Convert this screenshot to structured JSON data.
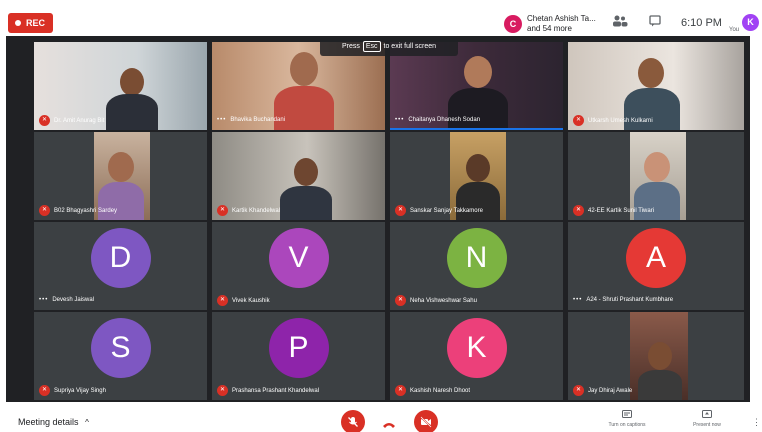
{
  "recording": {
    "label": "REC"
  },
  "presenter": {
    "avatar_letter": "C",
    "line1": "Chetan Ashish Ta...",
    "line2": "and 54 more"
  },
  "topbar": {
    "time": "6:10 PM",
    "you_label": "You",
    "self_avatar_letter": "K"
  },
  "banner": {
    "press": "Press",
    "key": "Esc",
    "rest": "to exit full screen"
  },
  "tiles": [
    {
      "name": "Dr. Amit Anurag Bit",
      "kind": "video"
    },
    {
      "name": "Bhavika Buchandani",
      "kind": "video"
    },
    {
      "name": "Chaitanya Dhanesh Sodan",
      "kind": "video"
    },
    {
      "name": "Utkarsh Umesh Kulkarni",
      "kind": "video"
    },
    {
      "name": "B02 Bhagyashri Sardey",
      "kind": "video"
    },
    {
      "name": "Kartik Khandelwal",
      "kind": "video"
    },
    {
      "name": "Sanskar Sanjay Takkamore",
      "kind": "video"
    },
    {
      "name": "42-EE Kartik Sunil Tiwari",
      "kind": "video"
    },
    {
      "name": "Devesh Jaiswal",
      "kind": "avatar",
      "letter": "D",
      "color": "#7e57c2"
    },
    {
      "name": "Vivek Kaushik",
      "kind": "avatar",
      "letter": "V",
      "color": "#ab47bc"
    },
    {
      "name": "Neha Vishweshwar Sahu",
      "kind": "avatar",
      "letter": "N",
      "color": "#7cb342"
    },
    {
      "name": "A24 - Shruti Prashant Kumbhare",
      "kind": "avatar",
      "letter": "A",
      "color": "#e53935"
    },
    {
      "name": "Supriya Vijay Singh",
      "kind": "avatar",
      "letter": "S",
      "color": "#7e57c2"
    },
    {
      "name": "Prashansa Prashant Khandelwal",
      "kind": "avatar",
      "letter": "P",
      "color": "#8e24aa"
    },
    {
      "name": "Kashish Naresh Dhoot",
      "kind": "avatar",
      "letter": "K",
      "color": "#ec407a"
    },
    {
      "name": "Jay Dhiraj Awale",
      "kind": "video"
    }
  ],
  "bottombar": {
    "meeting_details": "Meeting details",
    "captions_label": "Turn on captions",
    "present_label": "Present now"
  },
  "icons": {
    "mic_off": "mic-off-icon",
    "camera_off": "camera-off-icon",
    "hangup": "hangup-icon",
    "people": "people-icon",
    "chat": "chat-icon",
    "captions": "captions-icon",
    "present": "present-icon",
    "more": "more-vert-icon"
  },
  "colors": {
    "rec_red": "#d93025",
    "grid_bg": "#202124",
    "tile_bg": "#3c4043"
  }
}
